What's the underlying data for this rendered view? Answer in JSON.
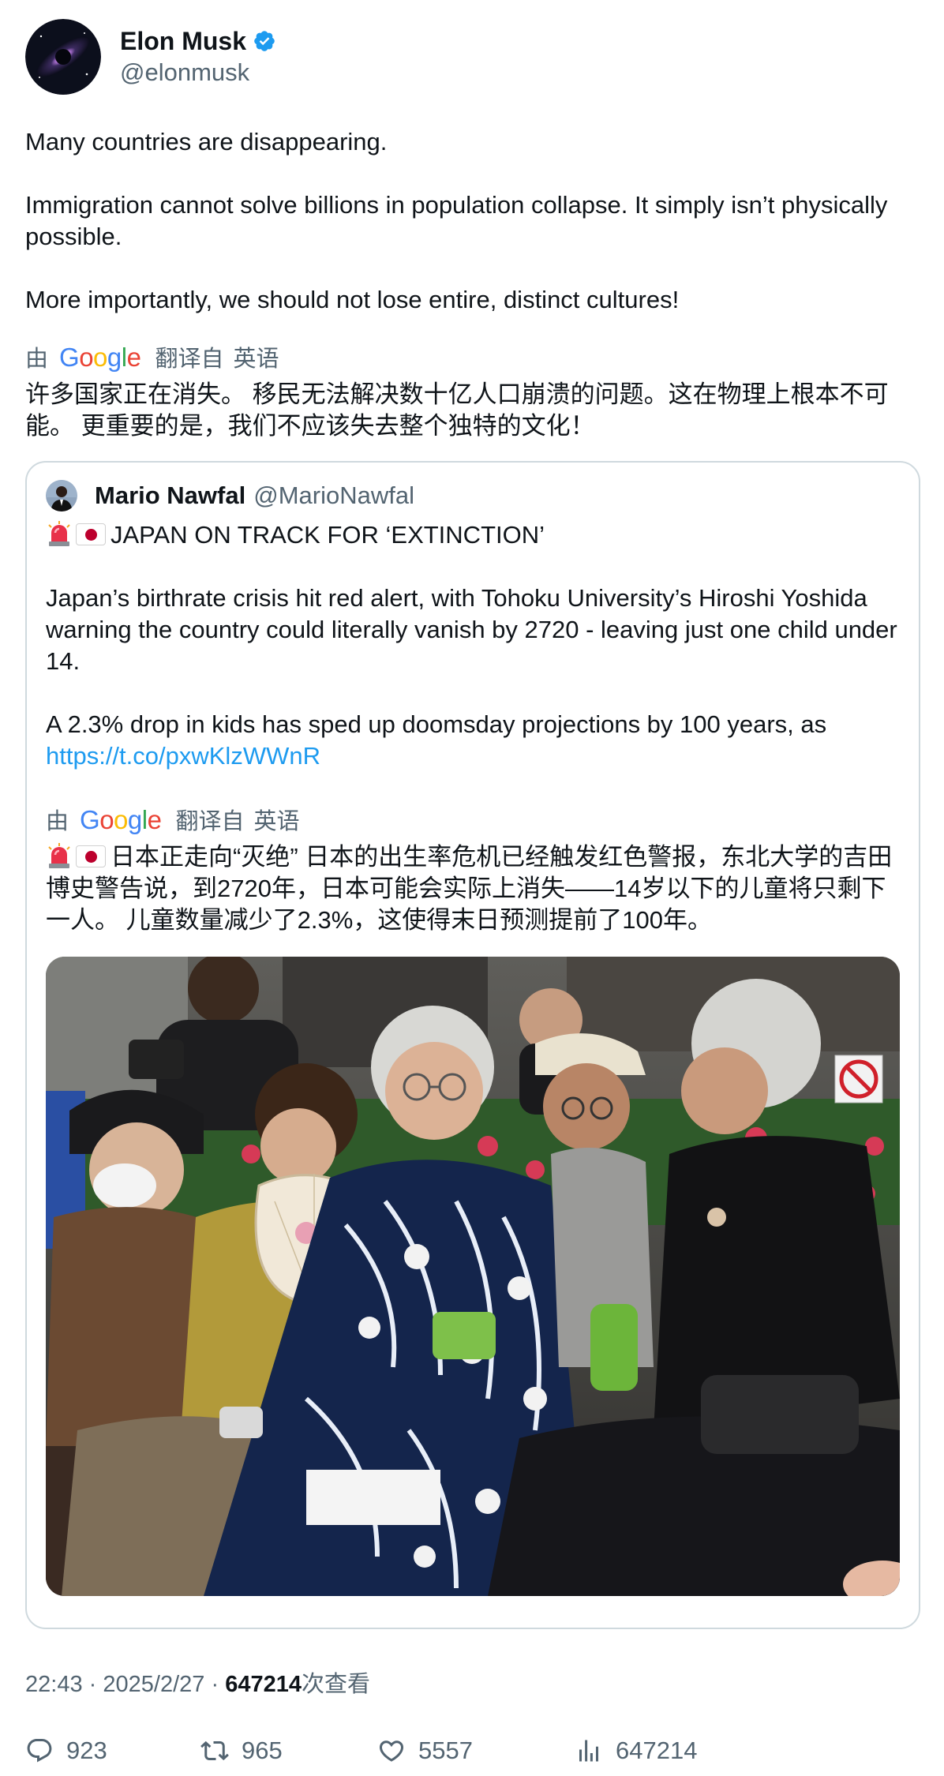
{
  "author": {
    "name": "Elon Musk",
    "handle": "@elonmusk",
    "verified_color": "#1d9bf0"
  },
  "tweet": {
    "paragraphs": [
      "Many countries are disappearing.",
      "Immigration cannot solve billions in population collapse. It simply isn’t physically possible.",
      "More importantly, we should not lose entire, distinct cultures!"
    ],
    "translated_by_prefix": "由",
    "translator": "Google",
    "translated_from": "翻译自",
    "source_language": "英语",
    "translation": "许多国家正在消失。 移民无法解决数十亿人口崩溃的问题。这在物理上根本不可能。 更重要的是，我们不应该失去整个独特的文化！"
  },
  "quoted": {
    "name": "Mario Nawfal",
    "handle": "@MarioNawfal",
    "headline": "JAPAN ON TRACK FOR ‘EXTINCTION’",
    "paragraph_2": "Japan’s birthrate crisis hit red alert, with Tohoku University’s Hiroshi Yoshida warning the country could literally vanish by 2720 - leaving just one child under 14.",
    "paragraph_3": "A 2.3% drop in kids has sped up doomsday projections by 100 years, as",
    "link": "https://t.co/pxwKlzWWnR",
    "translated_by_prefix": "由",
    "translator": "Google",
    "translated_from": "翻译自",
    "source_language": "英语",
    "translation": "日本正走向“灭绝” 日本的出生率危机已经触发红色警报，东北大学的吉田博史警告说，到2720年，日本可能会实际上消失——14岁以下的儿童将只剩下一人。 儿童数量减少了2.3%，这使得末日预测提前了100年。",
    "image_alt": "Elderly people sitting on a bench in Japan"
  },
  "meta": {
    "time": "22:43",
    "date": "2025/2/27",
    "separator": "·",
    "views": "647214",
    "views_suffix": "次查看"
  },
  "actions": {
    "replies": "923",
    "retweets": "965",
    "likes": "5557",
    "views": "647214"
  },
  "colors": {
    "text": "#0f1419",
    "secondary": "#536471",
    "link": "#1d9bf0",
    "border": "#cfd9de"
  }
}
